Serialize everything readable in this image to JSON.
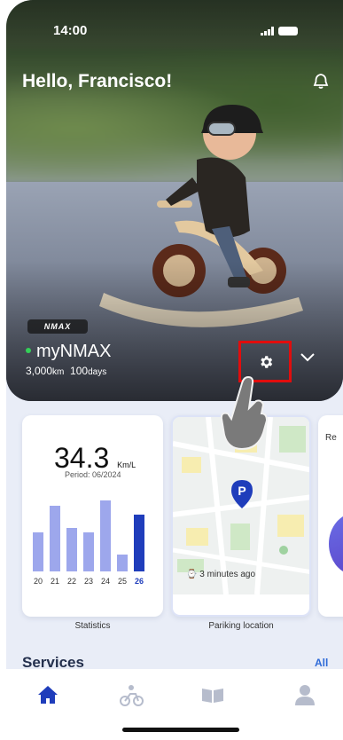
{
  "status_bar": {
    "time": "14:00"
  },
  "header": {
    "greeting": "Hello, Francisco!"
  },
  "vehicle": {
    "badge": "NMAX",
    "name": "myNMAX",
    "distance_value": "3,000",
    "distance_unit": "km",
    "days_value": "100",
    "days_unit": "days"
  },
  "statistics_card": {
    "value": "34.3",
    "unit": "Km/L",
    "period": "Period: 06/2024",
    "caption": "Statistics"
  },
  "chart_data": {
    "type": "bar",
    "categories": [
      "20",
      "21",
      "22",
      "23",
      "24",
      "25",
      "26"
    ],
    "values": [
      60,
      102,
      67,
      60,
      110,
      26,
      88
    ],
    "highlighted": "26",
    "colors": {
      "default": "#9da7ec",
      "highlight": "#1f3dbb"
    }
  },
  "parking_card": {
    "pin_letter": "P",
    "time": "3 minutes ago",
    "caption": "Pariking location"
  },
  "third_card": {
    "label": "Re"
  },
  "services": {
    "title": "Services",
    "all_label": "All"
  },
  "tabs": [
    {
      "icon": "home-icon",
      "active": true
    },
    {
      "icon": "motorbike-icon",
      "active": false
    },
    {
      "icon": "book-icon",
      "active": false
    },
    {
      "icon": "profile-icon",
      "active": false
    }
  ],
  "colors": {
    "accent": "#1f3dbb",
    "highlight_box": "#e10d0d",
    "link": "#2f6bd8"
  }
}
